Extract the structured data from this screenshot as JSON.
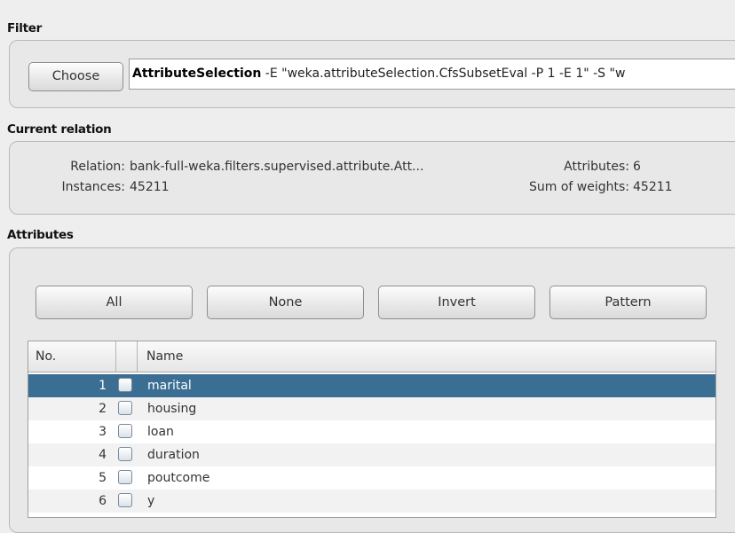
{
  "filter": {
    "title": "Filter",
    "choose_label": "Choose",
    "filter_name": "AttributeSelection",
    "filter_args": " -E \"weka.attributeSelection.CfsSubsetEval -P 1 -E 1\" -S \"w"
  },
  "relation": {
    "title": "Current relation",
    "relation_label": "Relation:",
    "relation_value": "bank-full-weka.filters.supervised.attribute.Att...",
    "attributes_label": "Attributes:",
    "attributes_value": "6",
    "instances_label": "Instances:",
    "instances_value": "45211",
    "weights_label": "Sum of weights:",
    "weights_value": "45211"
  },
  "attributes": {
    "title": "Attributes",
    "buttons": {
      "all": "All",
      "none": "None",
      "invert": "Invert",
      "pattern": "Pattern"
    },
    "columns": {
      "no": "No.",
      "name": "Name"
    },
    "rows": [
      {
        "no": "1",
        "name": "marital",
        "selected": true
      },
      {
        "no": "2",
        "name": "housing"
      },
      {
        "no": "3",
        "name": "loan"
      },
      {
        "no": "4",
        "name": "duration"
      },
      {
        "no": "5",
        "name": "poutcome"
      },
      {
        "no": "6",
        "name": "y"
      }
    ]
  },
  "colors": {
    "selection": "#3b6e93",
    "background": "#eeeeee"
  }
}
